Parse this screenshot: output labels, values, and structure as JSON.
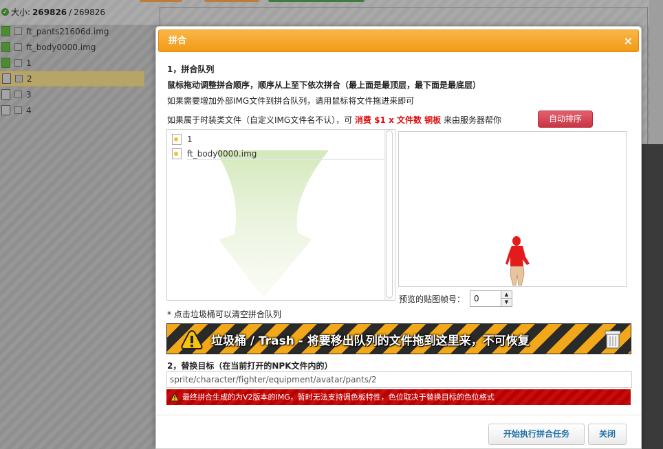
{
  "background": {
    "size_label": "大小:",
    "size_current": "269826",
    "size_separator": "/",
    "size_total": "269826",
    "files": [
      {
        "name": "ft_pants21606d.img",
        "icon": "green-file-icon"
      },
      {
        "name": "ft_body0000.img",
        "icon": "green-file-icon"
      },
      {
        "name": "1",
        "icon": "green-file-icon"
      },
      {
        "name": "2",
        "icon": "file-icon",
        "selected": true
      },
      {
        "name": "3",
        "icon": "file-icon"
      },
      {
        "name": "4",
        "icon": "file-icon"
      }
    ]
  },
  "dialog": {
    "title": "拼合",
    "close_glyph": "×",
    "section1_title": "1，拼合队列",
    "instruction_bold": "鼠标拖动调整拼合顺序，顺序从上至下依次拼合（最上面是最顶层，最下面是最底层）",
    "instruction_add": "如果需要增加外部IMG文件到拼合队列，请用鼠标将文件拖进来即可",
    "fashion_prefix": "如果属于时装类文件（自定义IMG文件名不认），可",
    "fashion_cost": "消费 $1 x 文件数 铜板",
    "fashion_suffix": "来由服务器帮你",
    "auto_sort_button": "自动排序",
    "queue_items": [
      "1",
      "ft_body0000.img"
    ],
    "frame_label": "预览的贴图帧号：",
    "frame_value": "0",
    "trash_hint": "* 点击垃圾桶可以清空拼合队列",
    "trash_text": "垃圾桶 / Trash  - 将要移出队列的文件拖到这里来，不可恢复",
    "section2_title": "2，替换目标（在当前打开的NPK文件内的）",
    "target_path": "sprite/character/fighter/equipment/avatar/pants/2",
    "warning_text": "最终拼合生成的为V2版本的IMG，暂时无法支持调色板特性，色位取决于替换目标的色位格式",
    "start_button": "开始执行拼合任务",
    "close_button": "关闭"
  },
  "colors": {
    "header_orange": "#f29a17",
    "accent_red": "#d11111",
    "link_blue": "#1f6fa8"
  }
}
